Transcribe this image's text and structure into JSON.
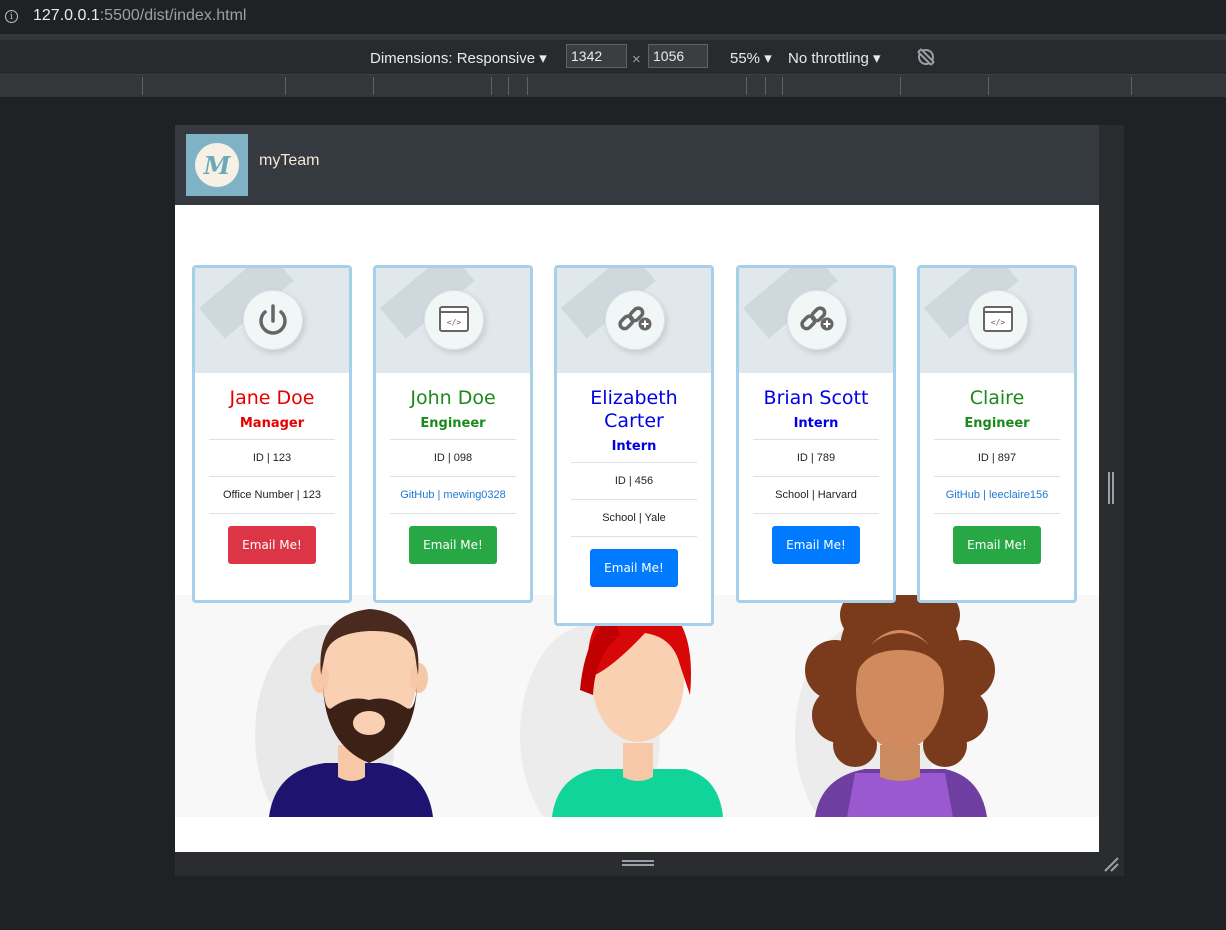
{
  "browser": {
    "url_host": "127.0.0.1",
    "url_rest": ":5500/dist/index.html",
    "devtools": {
      "dimensions_label": "Dimensions: Responsive",
      "width": "1342",
      "times": "×",
      "height": "1056",
      "zoom": "55%",
      "throttling": "No throttling"
    }
  },
  "page": {
    "brand": "myTeam",
    "logo_letter": "M",
    "cards": [
      {
        "name": "Jane Doe",
        "role": "Manager",
        "id": "ID | 123",
        "extra": "Office Number | 123",
        "button": "Email Me!",
        "icon": "power-icon",
        "color": "#e60000",
        "btn_color": "#dc3545",
        "extra_link": false
      },
      {
        "name": "John Doe",
        "role": "Engineer",
        "id": "ID | 098",
        "extra": "GitHub | mewing0328",
        "button": "Email Me!",
        "icon": "code-window-icon",
        "color": "#1a8a1a",
        "btn_color": "#28a745",
        "extra_link": true
      },
      {
        "name": "Elizabeth Carter",
        "role": "Intern",
        "id": "ID | 456",
        "extra": "School | Yale",
        "button": "Email Me!",
        "icon": "chain-link-icon",
        "color": "#0000e6",
        "btn_color": "#007bff",
        "extra_link": false
      },
      {
        "name": "Brian Scott",
        "role": "Intern",
        "id": "ID | 789",
        "extra": "School | Harvard",
        "button": "Email Me!",
        "icon": "chain-link-icon",
        "color": "#0000e6",
        "btn_color": "#007bff",
        "extra_link": false
      },
      {
        "name": "Claire",
        "role": "Engineer",
        "id": "ID | 897",
        "extra": "GitHub | leeclaire156",
        "button": "Email Me!",
        "icon": "code-window-icon",
        "color": "#1a8a1a",
        "btn_color": "#28a745",
        "extra_link": true
      }
    ]
  }
}
